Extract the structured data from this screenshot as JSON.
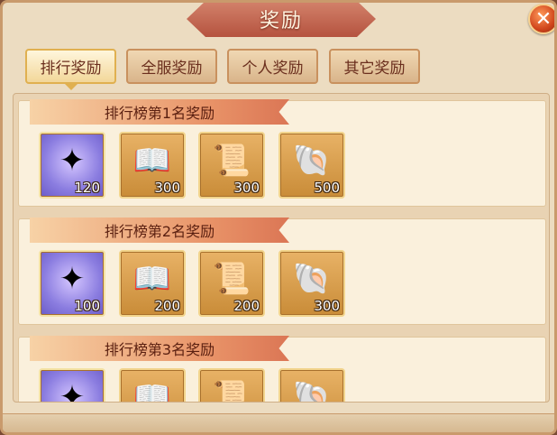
{
  "window": {
    "title": "奖励",
    "close_symbol": "✕"
  },
  "tabs": [
    {
      "label": "排行奖励",
      "active": true
    },
    {
      "label": "全服奖励",
      "active": false
    },
    {
      "label": "个人奖励",
      "active": false
    },
    {
      "label": "其它奖励",
      "active": false
    }
  ],
  "ranks": [
    {
      "label": "排行榜第1名奖励",
      "items": [
        {
          "icon": "rune-crest-icon",
          "count": "120"
        },
        {
          "icon": "open-book-icon",
          "count": "300"
        },
        {
          "icon": "scroll-icon",
          "count": "300"
        },
        {
          "icon": "blue-shell-icon",
          "count": "500"
        }
      ]
    },
    {
      "label": "排行榜第2名奖励",
      "items": [
        {
          "icon": "rune-crest-icon",
          "count": "100"
        },
        {
          "icon": "open-book-icon",
          "count": "200"
        },
        {
          "icon": "scroll-icon",
          "count": "200"
        },
        {
          "icon": "blue-shell-icon",
          "count": "300"
        }
      ]
    },
    {
      "label": "排行榜第3名奖励",
      "items": [
        {
          "icon": "rune-crest-icon",
          "count": ""
        },
        {
          "icon": "open-book-icon",
          "count": ""
        },
        {
          "icon": "scroll-icon",
          "count": ""
        },
        {
          "icon": "blue-shell-icon",
          "count": ""
        }
      ]
    }
  ],
  "colors": {
    "panel_bg": "#ecdcc1",
    "title_plate": "#b5533f",
    "item_gold": "#c98c38",
    "item_purple": "#8b7de0"
  }
}
